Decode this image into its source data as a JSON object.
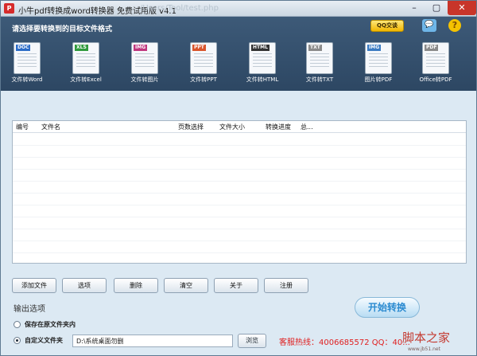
{
  "window": {
    "title": "小牛pdf转换成word转换器 免费试用版 v4.1",
    "ghost_title": "/Users/Tool/test.php",
    "min_glyph": "–",
    "max_glyph": "▢",
    "close_glyph": "✕"
  },
  "header": {
    "prompt": "请选择要转换到的目标文件格式",
    "qq_label": "QQ交谈",
    "chat_glyph": "💬",
    "help_glyph": "?",
    "tools": [
      {
        "tag": "DOC",
        "label": "文件转Word",
        "color": "#2b6cc8"
      },
      {
        "tag": "XLS",
        "label": "文件转Excel",
        "color": "#2f9a3c"
      },
      {
        "tag": "IMG",
        "label": "文件转图片",
        "color": "#c0367e"
      },
      {
        "tag": "PPT",
        "label": "文件转PPT",
        "color": "#d9542b"
      },
      {
        "tag": "HTML",
        "label": "文件转HTML",
        "color": "#333333"
      },
      {
        "tag": "TXT",
        "label": "文件转TXT",
        "color": "#8a8a8a"
      },
      {
        "tag": "IMG",
        "label": "图片转PDF",
        "color": "#3b7bc2"
      },
      {
        "tag": "PDF",
        "label": "Office转PDF",
        "color": "#8a8a8a"
      }
    ]
  },
  "table": {
    "headers": [
      "编号",
      "文件名",
      "页数选择",
      "文件大小",
      "转换进度",
      "总..."
    ]
  },
  "actions": [
    "添加文件",
    "选项",
    "删除",
    "清空",
    "关于",
    "注册"
  ],
  "output": {
    "title": "输出选项",
    "option_same_folder": "保存在原文件夹内",
    "option_custom_folder": "自定义文件夹",
    "path_value": "D:\\系统桌面勿删",
    "browse_label": "浏览",
    "start_label": "开始转换"
  },
  "hotline": "客服热线：4006685572 QQ：40...",
  "watermark": {
    "text": "脚本之家",
    "url": "www.jb51.net"
  }
}
